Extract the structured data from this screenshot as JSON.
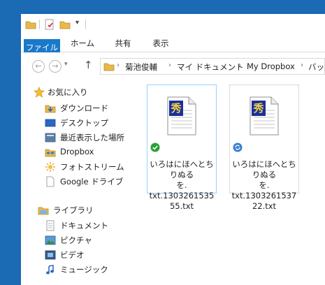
{
  "ribbon": {
    "tabs": [
      "ファイル",
      "ホーム",
      "共有",
      "表示"
    ]
  },
  "address": {
    "crumbs": [
      "菊池俊輔",
      "マイ ドキュメント",
      "My Dropbox",
      "バック"
    ]
  },
  "nav": {
    "favorites_label": "お気に入り",
    "favorites": [
      "ダウンロード",
      "デスクトップ",
      "最近表示した場所",
      "Dropbox",
      "フォトストリーム",
      "Google ドライブ"
    ],
    "libraries_label": "ライブラリ",
    "libraries": [
      "ドキュメント",
      "ピクチャ",
      "ビデオ",
      "ミュージック"
    ]
  },
  "files": [
    {
      "line1": "いろはにほへとちりぬる",
      "line2": "を.",
      "line3": "txt.1303261535",
      "line4": "55.txt",
      "status": "synced"
    },
    {
      "line1": "いろはにほへとちりぬる",
      "line2": "を.",
      "line3": "txt.1303261537",
      "line4": "22.txt",
      "status": "syncing"
    }
  ],
  "colors": {
    "accent": "#1979ca",
    "desktop": "#1a6ab4",
    "synced": "#2e9e3a",
    "syncing": "#3a7fd4"
  }
}
